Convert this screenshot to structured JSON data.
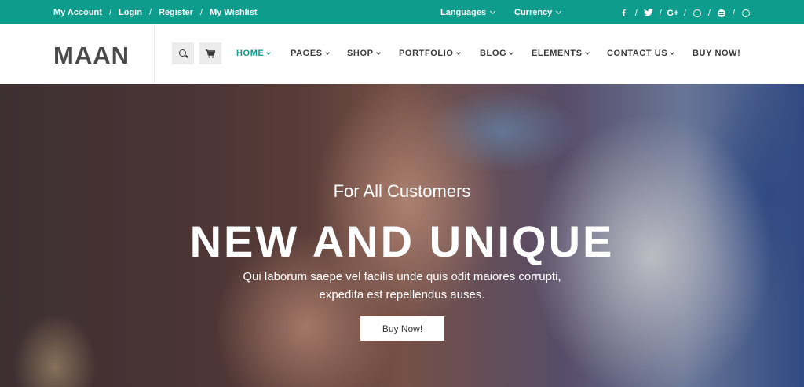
{
  "topbar": {
    "links": [
      "My Account",
      "Login",
      "Register",
      "My Wishlist"
    ],
    "separator": "/",
    "languages_label": "Languages",
    "currency_label": "Currency",
    "social_separator": "/",
    "social_icons": [
      "facebook-icon",
      "twitter-icon",
      "google-plus-icon",
      "dribbble-icon",
      "spotify-icon",
      "skype-icon"
    ],
    "social_glyphs": [
      "f",
      "✔",
      "G+",
      "",
      "",
      ""
    ]
  },
  "header": {
    "logo": "MAAN",
    "nav": [
      "HOME",
      "PAGES",
      "SHOP",
      "PORTFOLIO",
      "BLOG",
      "ELEMENTS",
      "CONTACT US",
      "BUY NOW!"
    ],
    "active_nav": "HOME"
  },
  "hero": {
    "subtitle": "For All Customers",
    "title": "NEW AND UNIQUE",
    "description": "Qui laborum saepe vel facilis unde quis odit maiores corrupti, expedita est repellendus auses.",
    "button_label": "Buy Now!"
  },
  "colors": {
    "accent": "#0e9c8c",
    "nav_text": "#3a3a3a",
    "logo": "#4a4a4a"
  }
}
